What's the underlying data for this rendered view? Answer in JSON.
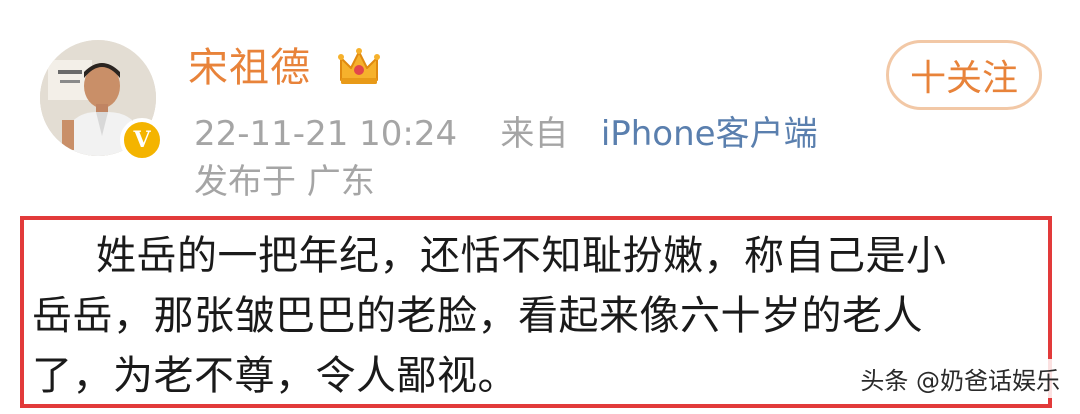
{
  "header": {
    "username": "宋祖德",
    "verified_badge": "V",
    "follow_label": "十关注",
    "timestamp": "22-11-21 10:24",
    "source_prefix": "来自",
    "source_client": "iPhone客户端",
    "location": "发布于 广东"
  },
  "post": {
    "lines": [
      "姓岳的一把年纪，还恬不知耻扮嫩，称自己是小",
      "岳岳，那张皱巴巴的老脸，看起来像六十岁的老人",
      "了，为老不尊，令人鄙视。"
    ]
  },
  "watermark": "头条 @奶爸话娱乐",
  "colors": {
    "username": "#e8833a",
    "highlight_border": "#e23a3a",
    "source_link": "#5a7fae",
    "meta_gray": "#a5a5a5",
    "verified_gold": "#f4b400"
  },
  "icons": {
    "crown": "crown-icon",
    "verified": "verified-v-badge-icon"
  }
}
